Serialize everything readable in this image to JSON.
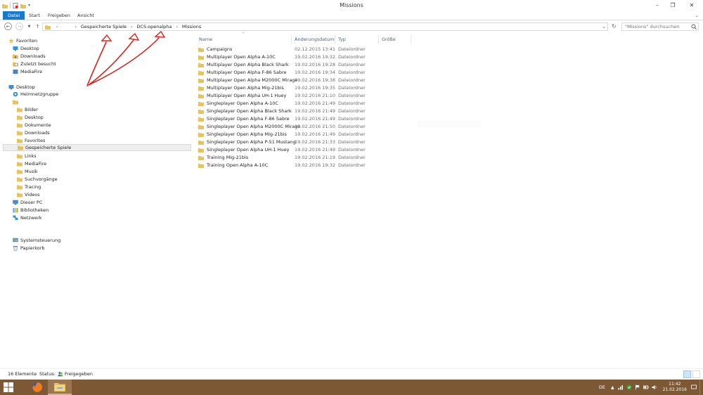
{
  "window": {
    "title": "Missions"
  },
  "ribbon": {
    "tabs": [
      {
        "label": "Datei",
        "active": true
      },
      {
        "label": "Start",
        "active": false
      },
      {
        "label": "Freigeben",
        "active": false
      },
      {
        "label": "Ansicht",
        "active": false
      }
    ]
  },
  "address": {
    "crumbs": [
      "Gespeicherte Spiele",
      "DCS.openalpha",
      "Missions"
    ]
  },
  "search": {
    "placeholder": "\"Missions\" durchsuchen"
  },
  "navpane": {
    "favorites_label": "Favoriten",
    "favorites": [
      "Desktop",
      "Downloads",
      "Zuletzt besucht",
      "MediaFire"
    ],
    "desktop_label": "Desktop",
    "homegroup_label": "Heimnetzgruppe",
    "user_folders": [
      "Bilder",
      "Desktop",
      "Dokumente",
      "Downloads",
      "Favorites",
      "Gespeicherte Spiele",
      "Links",
      "MediaFire",
      "Musik",
      "Suchvorgänge",
      "Tracing",
      "Videos"
    ],
    "selected": "Gespeicherte Spiele",
    "pc_label": "Dieser PC",
    "libraries_label": "Bibliotheken",
    "network_label": "Netzwerk",
    "control_panel_label": "Systemsteuerung",
    "recycle_bin_label": "Papierkorb"
  },
  "columns": {
    "name": "Name",
    "date": "Änderungsdatum",
    "type": "Typ",
    "size": "Größe"
  },
  "files": [
    {
      "name": "Campaigns",
      "date": "02.12.2015 13:41",
      "type": "Dateiordner"
    },
    {
      "name": "Multiplayer Open Alpha A-10C",
      "date": "19.02.2016 19:32",
      "type": "Dateiordner"
    },
    {
      "name": "Multiplayer Open Alpha Black Shark",
      "date": "19.02.2016 19:28",
      "type": "Dateiordner"
    },
    {
      "name": "Multiplayer Open Alpha F-86 Sabre",
      "date": "19.02.2016 19:34",
      "type": "Dateiordner"
    },
    {
      "name": "Multiplayer Open Alpha M2000C Mirage",
      "date": "19.02.2016 19:38",
      "type": "Dateiordner"
    },
    {
      "name": "Multiplayer Open Alpha Mig-21bis",
      "date": "19.02.2016 19:35",
      "type": "Dateiordner"
    },
    {
      "name": "Multiplayer Open Alpha UH-1 Huey",
      "date": "19.02.2016 21:10",
      "type": "Dateiordner"
    },
    {
      "name": "Singleplayer Open Alpha A-10C",
      "date": "19.02.2016 21:49",
      "type": "Dateiordner"
    },
    {
      "name": "Singleplayer Open Alpha Black Shark",
      "date": "19.02.2016 21:49",
      "type": "Dateiordner"
    },
    {
      "name": "Singleplayer Open Alpha F-86 Sabre",
      "date": "19.02.2016 21:49",
      "type": "Dateiordner"
    },
    {
      "name": "Singleplayer Open Alpha M2000C Mirage",
      "date": "19.02.2016 21:50",
      "type": "Dateiordner"
    },
    {
      "name": "Singleplayer Open Alpha Mig-21bis",
      "date": "19.02.2016 21:49",
      "type": "Dateiordner"
    },
    {
      "name": "Singleplayer Open Alpha P-51 Mustang",
      "date": "19.02.2016 21:33",
      "type": "Dateiordner"
    },
    {
      "name": "Singleplayer Open Alpha UH-1 Huey",
      "date": "19.02.2016 21:49",
      "type": "Dateiordner"
    },
    {
      "name": "Training Mig-21bis",
      "date": "19.02.2016 21:19",
      "type": "Dateiordner"
    },
    {
      "name": "Training Open Alpha A-10C",
      "date": "19.02.2016 19:32",
      "type": "Dateiordner"
    }
  ],
  "status": {
    "count": "16 Elemente",
    "status_label": "Status:",
    "share_state": "Freigegeben"
  },
  "taskbar": {
    "lang": "DE",
    "time": "11:42",
    "date": "21.02.2016"
  },
  "colors": {
    "accent": "#1979ca",
    "folder": "#e8c25a",
    "taskbar": "#7c5834",
    "annotation": "#d9231f"
  }
}
